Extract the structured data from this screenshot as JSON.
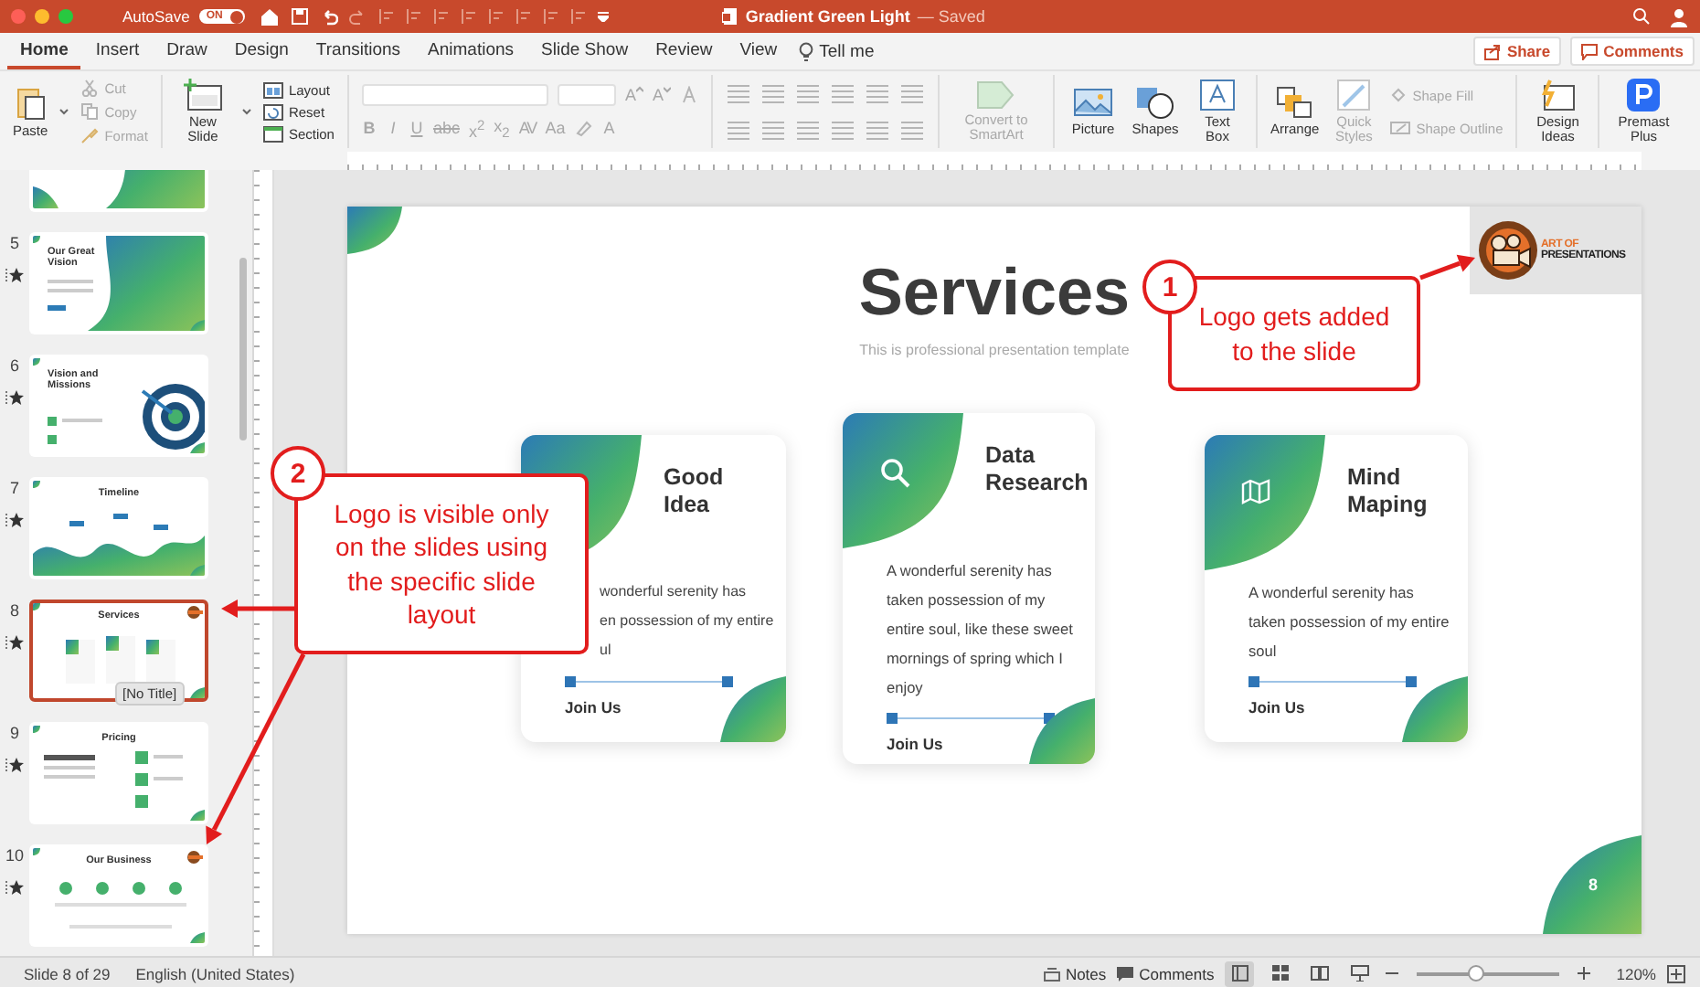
{
  "window": {
    "title": "Gradient Green Light",
    "status": "— Saved"
  },
  "autosave": {
    "label": "AutoSave",
    "on": true,
    "state_text": "ON"
  },
  "tabs": [
    {
      "label": "Home",
      "selected": true
    },
    {
      "label": "Insert",
      "selected": false
    },
    {
      "label": "Draw",
      "selected": false
    },
    {
      "label": "Design",
      "selected": false
    },
    {
      "label": "Transitions",
      "selected": false
    },
    {
      "label": "Animations",
      "selected": false
    },
    {
      "label": "Slide Show",
      "selected": false
    },
    {
      "label": "Review",
      "selected": false
    },
    {
      "label": "View",
      "selected": false
    }
  ],
  "tell_me": "Tell me",
  "share_button": "Share",
  "comments_button": "Comments",
  "ribbon": {
    "paste": "Paste",
    "clipboard_items": [
      {
        "label": "Cut",
        "kind": "cut",
        "disabled": true
      },
      {
        "label": "Copy",
        "kind": "copy",
        "disabled": true
      },
      {
        "label": "Format",
        "kind": "format",
        "disabled": true
      }
    ],
    "new_slide": "New Slide",
    "slide_items": [
      {
        "label": "Layout",
        "kind": "layout"
      },
      {
        "label": "Reset",
        "kind": "reset"
      },
      {
        "label": "Section",
        "kind": "section"
      }
    ],
    "font_size_buttons": [
      {
        "label": "A",
        "kind": "grow"
      },
      {
        "label": "A",
        "kind": "shrink"
      }
    ],
    "format_buttons": [
      {
        "label": "B",
        "kind": "bold"
      },
      {
        "label": "I",
        "kind": "italic"
      },
      {
        "label": "U",
        "kind": "underline"
      },
      {
        "label": "abc",
        "kind": "strike"
      },
      {
        "label": "x$^{2}$",
        "kind": "plain"
      },
      {
        "label": "x$_{2}$",
        "kind": "plain"
      },
      {
        "label": "AV",
        "kind": "spacing"
      },
      {
        "label": "Aa",
        "kind": "plain"
      }
    ],
    "font_color": "A",
    "smartart": {
      "label": "Convert to SmartArt",
      "disabled": true
    },
    "insert_items": [
      {
        "label": "Picture",
        "kind": "picture"
      },
      {
        "label": "Shapes",
        "kind": "shapes"
      },
      {
        "label": "Text Box",
        "kind": "textbox"
      }
    ],
    "arrange": "Arrange",
    "quick_styles": {
      "label": "Quick Styles",
      "disabled": true
    },
    "shape_items": [
      {
        "label": "Shape Fill",
        "kind": "fill",
        "disabled": true
      },
      {
        "label": "Shape Outline",
        "kind": "outline",
        "disabled": true
      }
    ],
    "design_ideas": "Design Ideas",
    "premast": "Premast Plus"
  },
  "thumbnails": [
    {
      "number": "5",
      "title": "Our Great Vision",
      "kind": "vision",
      "selected": false,
      "logo": false
    },
    {
      "number": "6",
      "title": "Vision and Missions",
      "kind": "missions",
      "selected": false,
      "logo": false
    },
    {
      "number": "7",
      "title": "Timeline",
      "kind": "timeline",
      "selected": false,
      "logo": false
    },
    {
      "number": "8",
      "title": "Services",
      "kind": "services",
      "selected": true,
      "logo": true
    },
    {
      "number": "9",
      "title": "Pricing",
      "kind": "pricing",
      "selected": false,
      "logo": false
    },
    {
      "number": "10",
      "title": "Our Business",
      "kind": "business",
      "selected": false,
      "logo": true
    }
  ],
  "tooltip": "[No Title]",
  "slide": {
    "title": "Services",
    "subtitle": "This is professional presentation template",
    "logo": {
      "line1": "ART OF",
      "line2": "PRESENTATIONS"
    },
    "page_number": "8",
    "cards": [
      {
        "title": "Good Idea",
        "kind": "plain",
        "clipped": true,
        "body": "wonderful serenity has\nen possession of my entire\nul",
        "link": "Join Us"
      },
      {
        "title": "Data Research",
        "kind": "search",
        "clipped": false,
        "body": "A wonderful serenity has taken possession of my entire soul, like these sweet mornings of spring which I enjoy",
        "link": "Join Us"
      },
      {
        "title": "Mind Maping",
        "kind": "map",
        "clipped": false,
        "body": "A wonderful serenity has taken possession of my entire soul",
        "link": "Join Us"
      }
    ]
  },
  "callouts": [
    {
      "number": "1",
      "text": "Logo gets added to the slide"
    },
    {
      "number": "2",
      "text": "Logo is visible only on the slides using the specific slide layout"
    }
  ],
  "status_bar": {
    "slide_info": "Slide 8 of 29",
    "language": "English (United States)",
    "notes": "Notes",
    "comments": "Comments",
    "views": [
      {
        "kind": "normal",
        "selected": true
      },
      {
        "kind": "sorter",
        "selected": false
      },
      {
        "kind": "reading",
        "selected": false
      },
      {
        "kind": "slideshow",
        "selected": false
      }
    ],
    "zoom": {
      "level": 0.42,
      "reading": "120%"
    }
  }
}
